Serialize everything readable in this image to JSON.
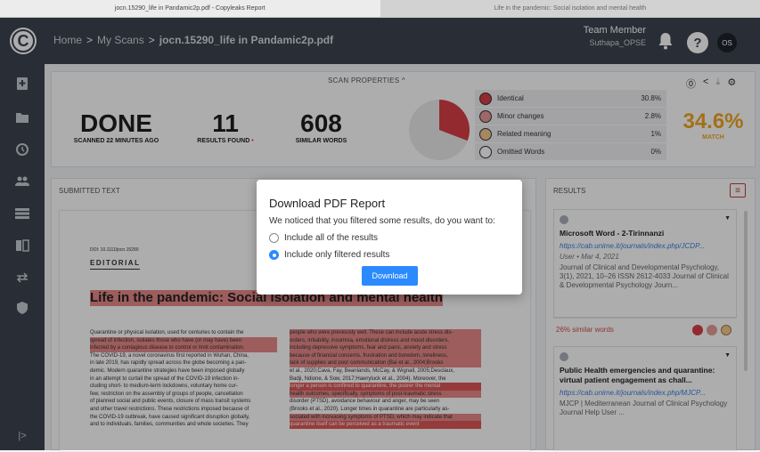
{
  "tabs": [
    {
      "label": "jocn.15290_life in Pandamic2p.pdf - Copyleaks Report"
    },
    {
      "label": "Life in the pandemic: Social isolation and mental health"
    }
  ],
  "breadcrumb": {
    "home": "Home",
    "sep": ">",
    "scans": "My Scans",
    "current": "jocn.15290_life in Pandamic2p.pdf"
  },
  "user": {
    "role": "Team Member",
    "name": "Suthapa_OPSE",
    "initials": "OS"
  },
  "props": {
    "title": "SCAN PROPERTIES",
    "status": "DONE",
    "status_sub": "SCANNED 22 MINUTES AGO",
    "results_found": "11",
    "results_label": "RESULTS FOUND",
    "similar_words": "608",
    "similar_label": "SIMILAR WORDS",
    "match_pct": "34.6%",
    "match_label": "MATCH",
    "legend": [
      {
        "label": "Identical",
        "pct": "30.8%",
        "color": "#d83f47"
      },
      {
        "label": "Minor changes",
        "pct": "2.8%",
        "color": "#e89a9a"
      },
      {
        "label": "Related meaning",
        "pct": "1%",
        "color": "#f3c890"
      },
      {
        "label": "Omitted Words",
        "pct": "0%",
        "color": "#ffffff"
      }
    ]
  },
  "submitted": {
    "header": "SUBMITTED TEXT",
    "doi": "DOI: 10.1111/jocn.15290",
    "section": "EDITORIAL",
    "doc_title": "Life in the pandemic: Social isolation and mental health",
    "col1": [
      "Quarantine or physical isolation, used for centuries to contain the",
      "spread of infection, isolates those who have (or may have) been",
      "infected by a contagious disease to control or limit contamination.",
      "The COVID-19, a novel coronavirus first reported in Wuhan, China,",
      "in late 2019, has rapidly spread across the globe becoming a pan-",
      "demic. Modern quarantine strategies have been imposed globally",
      "in an attempt to curtail the spread of the COVID-19 infection in-",
      "cluding short- to medium-term lockdowns, voluntary home cur-",
      "few, restriction on the assembly of groups of people, cancellation",
      "of planned social and public events, closure of mass transit systems",
      "and other travel restrictions. These restrictions imposed because of",
      "the COVID-19 outbreak, have caused significant disruption globally,",
      "and to individuals, families, communities and whole societies. They"
    ],
    "col2": [
      "people who were previously well. These can include acute stress dis-",
      "orders, irritability, insomnia, emotional distress and mood disorders,",
      "including depressive symptoms, fear and panic, anxiety and stress",
      "because of financial concerns, frustration and boredom, loneliness,",
      "lack of supplies and poor communication (Bai et al., 2004;Brooks",
      "et al., 2020;Cava, Fay, Beanlands, McCay, & Wignall, 2005;Desclaux,",
      "Badji, Ndione, & Sow, 2017;Hawryluck et al., 2004). Moreover, the",
      "longer a person is confined to quarantine, the poorer the mental",
      "health outcomes, specifically, symptoms of post-traumatic stress",
      "disorder (PTSD), avoidance behaviour and anger, may be seen",
      "(Brooks et al., 2020). Longer times in quarantine are particularly as-",
      "sociated with increasing symptoms of PTSD, which may indicate that",
      "quarantine itself can be perceived as a traumatic event"
    ]
  },
  "results": {
    "header": "RESULTS",
    "cards": [
      {
        "title": "Microsoft Word - 2-Tirinnanzi",
        "url": "https://cab.unime.it/journals/index.php/JCDP...",
        "meta": "User • Mar 4, 2021",
        "desc": "Journal of Clinical and Developmental Psychology, 3(1), 2021, 10–26 ISSN 2612-4033 Journal of Clinical & Developmental Psychology Journ...",
        "similar": "26% similar words"
      },
      {
        "title": "Public Health emergencies and quarantine: virtual patient engagement as chall...",
        "url": "https://cab.unime.it/journals/index.php/MJCP...",
        "desc": "MJCP | Mediterranean Journal of Clinical Psychology Journal Help User ..."
      }
    ]
  },
  "modal": {
    "title": "Download PDF Report",
    "question": "We noticed that you filtered some results, do you want to:",
    "option_all": "Include all of the results",
    "option_filtered": "Include only filtered results",
    "button": "Download"
  }
}
